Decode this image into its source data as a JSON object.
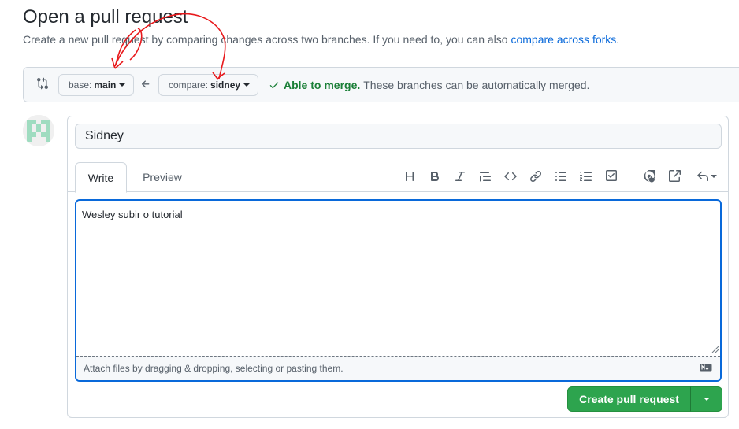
{
  "header": {
    "title": "Open a pull request",
    "subtitle": "Create a new pull request by comparing changes across two branches. If you need to, you can also",
    "subtitle_link": "compare across forks",
    "subtitle_end": "."
  },
  "range": {
    "base_prefix": "base:",
    "base_branch": "main",
    "compare_prefix": "compare:",
    "compare_branch": "sidney",
    "merge_ok": "Able to merge.",
    "merge_message": "These branches can be automatically merged."
  },
  "composer": {
    "title_value": "Sidney",
    "tabs": {
      "write": "Write",
      "preview": "Preview"
    },
    "toolbar": [
      "heading-icon",
      "bold-icon",
      "italic-icon",
      "quote-icon",
      "code-icon",
      "link-icon",
      "unordered-list-icon",
      "ordered-list-icon",
      "task-list-icon",
      "mention-icon",
      "reference-icon",
      "reply-icon"
    ],
    "body_value": "Wesley subir o tutorial",
    "attach_hint": "Attach files by dragging & dropping, selecting or pasting them.",
    "submit_label": "Create pull request"
  },
  "colors": {
    "primary_green": "#2da44e",
    "link_blue": "#0969da",
    "annotation_red": "#e8191c",
    "merge_green": "#1a7f37"
  }
}
